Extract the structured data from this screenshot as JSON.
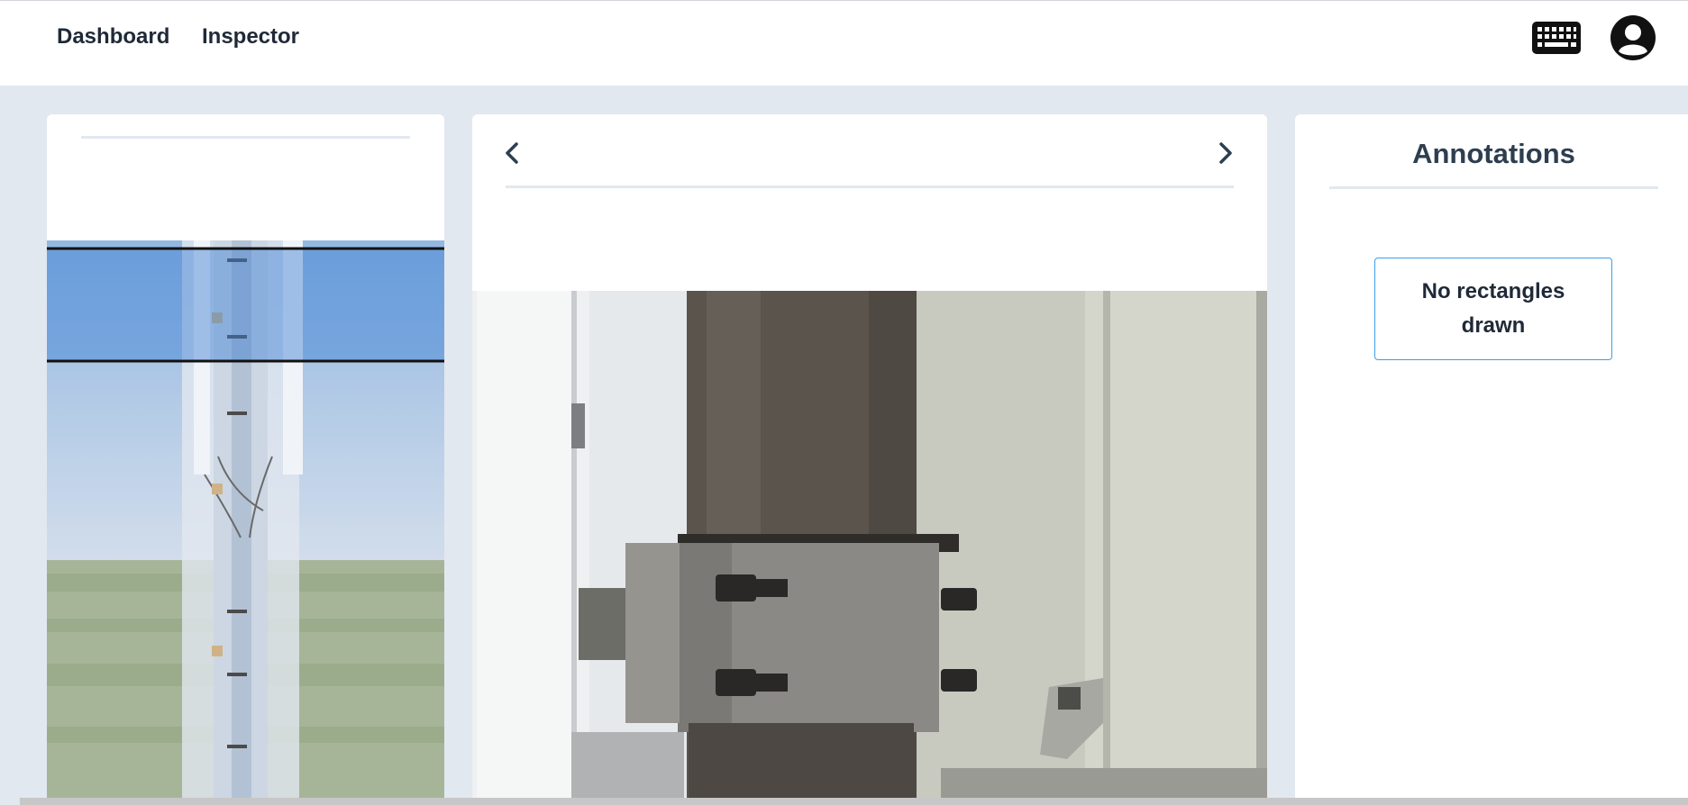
{
  "nav": {
    "dashboard_label": "Dashboard",
    "inspector_label": "Inspector"
  },
  "header_icons": {
    "keyboard": "keyboard-icon",
    "account": "user-circle-icon"
  },
  "viewer": {
    "prev_icon": "chevron-left-icon",
    "next_icon": "chevron-right-icon"
  },
  "annotations": {
    "title": "Annotations",
    "empty_message": "No rectangles drawn"
  },
  "colors": {
    "background": "#e2e8f0",
    "panel": "#ffffff",
    "accent_border": "#3b9fe8",
    "title_text": "#2d3e50"
  }
}
